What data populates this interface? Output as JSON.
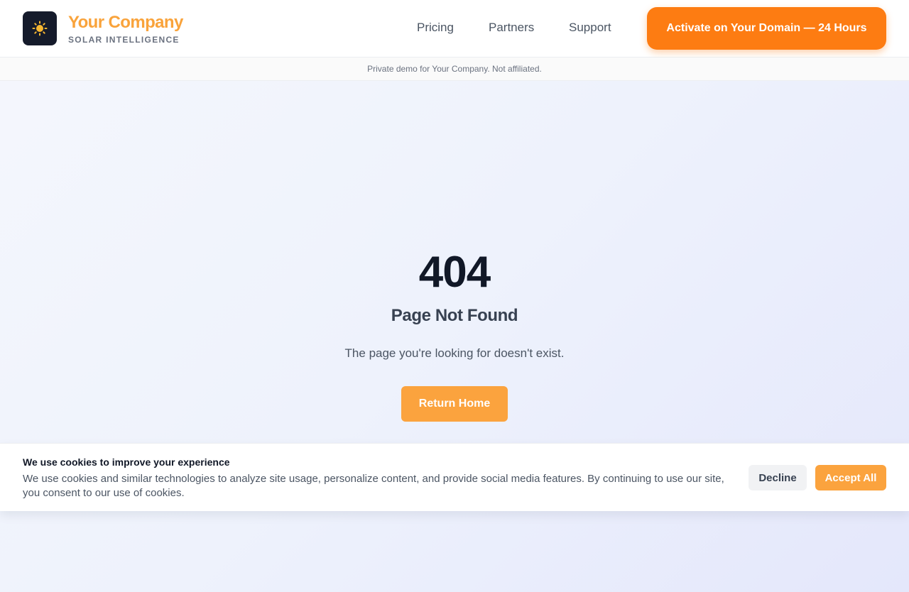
{
  "header": {
    "logo_icon": "sun-icon",
    "brand_name": "Your Company",
    "brand_tagline": "SOLAR INTELLIGENCE",
    "nav": [
      "Pricing",
      "Partners",
      "Support"
    ],
    "cta_label": "Activate on Your Domain — 24 Hours"
  },
  "disclaimer": "Private demo for Your Company. Not affiliated.",
  "error": {
    "code": "404",
    "title": "Page Not Found",
    "message": "The page you're looking for doesn't exist.",
    "button_label": "Return Home"
  },
  "cookie_banner": {
    "title": "We use cookies to improve your experience",
    "text": "We use cookies and similar technologies to analyze site usage, personalize content, and provide social media features. By continuing to use our site, you consent to our use of cookies.",
    "decline_label": "Decline",
    "accept_label": "Accept All"
  },
  "colors": {
    "brand": "#f9a33b",
    "cta": "#fd7c12",
    "button": "#fba33e",
    "logo_bg": "#151b2b"
  }
}
